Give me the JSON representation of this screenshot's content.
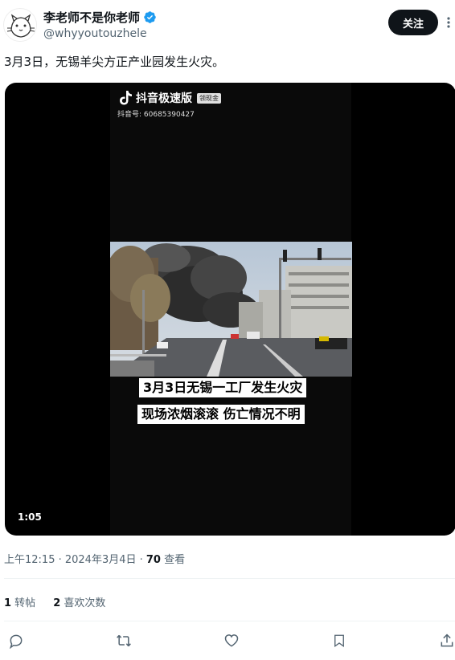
{
  "author": {
    "display_name": "李老师不是你老师",
    "handle": "@whyyoutouzhele",
    "verified": true
  },
  "follow_label": "关注",
  "tweet_text": "3月3日，无锡羊尖方正产业园发生火灾。",
  "video": {
    "watermark_app": "抖音极速版",
    "watermark_badge": "领现金",
    "watermark_id": "抖音号: 60685390427",
    "caption_line1": "3月3日无锡一工厂发生火灾",
    "caption_line2": "现场浓烟滚滚 伤亡情况不明",
    "duration": "1:05"
  },
  "meta": {
    "time_date": "上午12:15 · 2024年3月4日 · ",
    "views_count": "70",
    "views_label": " 查看"
  },
  "stats": {
    "retweets_count": "1",
    "retweets_label": " 转帖",
    "likes_count": "2",
    "likes_label": " 喜欢次数"
  },
  "actions": [
    "reply-icon",
    "retweet-icon",
    "like-icon",
    "bookmark-icon",
    "share-icon"
  ],
  "colors": {
    "text_primary": "#0f1419",
    "text_secondary": "#536471",
    "verified_blue": "#1d9bf0",
    "divider": "#eff3f4"
  }
}
